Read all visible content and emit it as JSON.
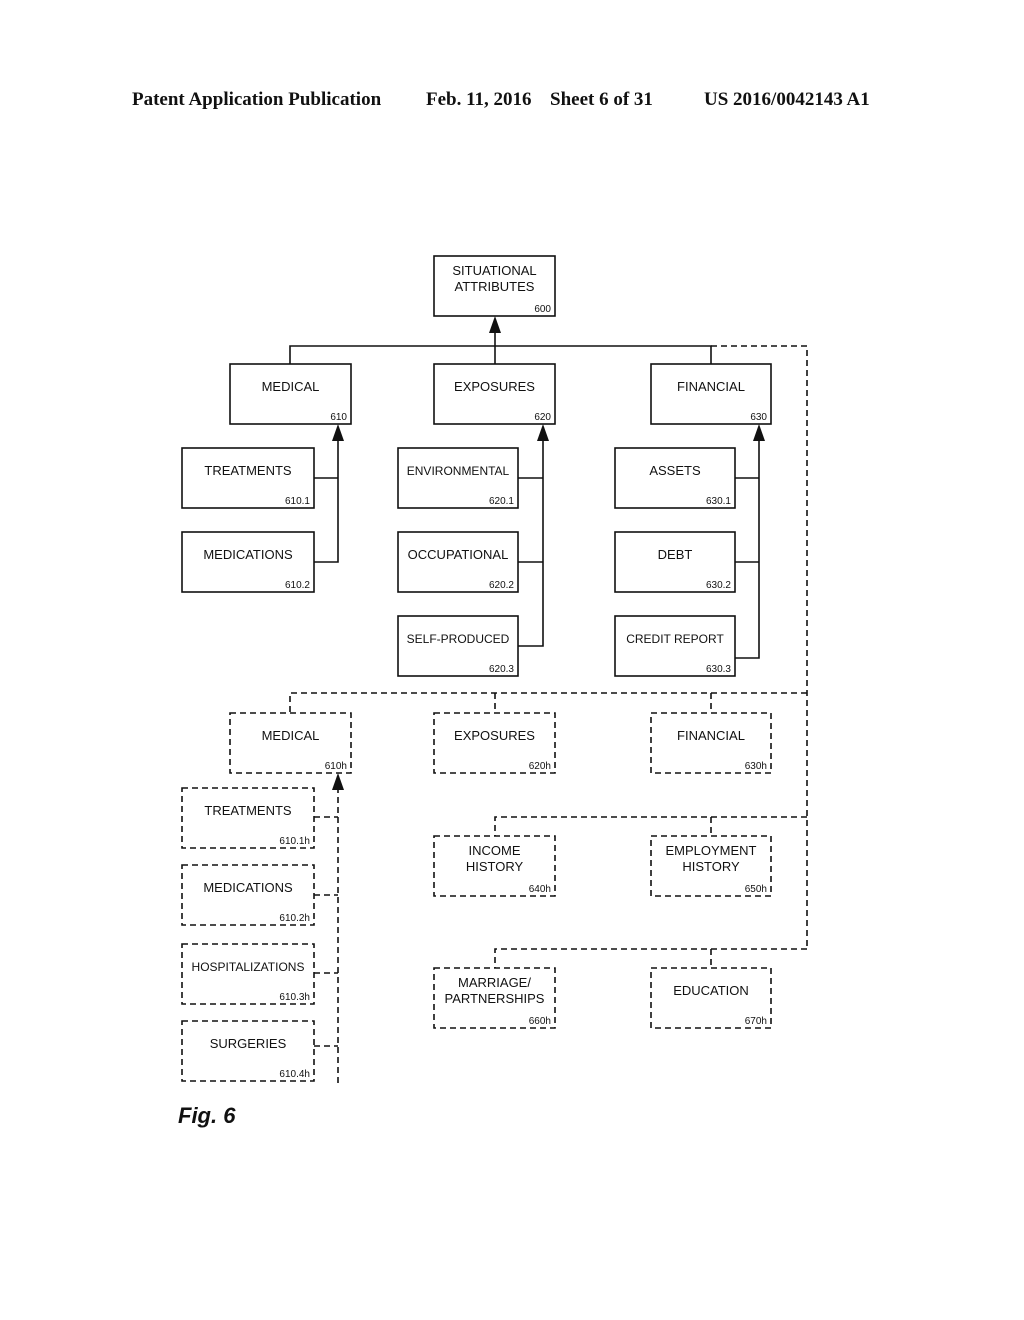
{
  "header": {
    "publication": "Patent Application Publication",
    "date": "Feb. 11, 2016",
    "sheet": "Sheet 6 of 31",
    "number": "US 2016/0042143 A1"
  },
  "figure_label": "Fig. 6",
  "diagram": {
    "root": {
      "id": "root",
      "lines": [
        "SITUATIONAL",
        "ATTRIBUTES"
      ],
      "ref": "600",
      "style": "solid"
    },
    "nodes": [
      {
        "id": "n610",
        "lines": [
          "MEDICAL"
        ],
        "ref": "610",
        "style": "solid"
      },
      {
        "id": "n620",
        "lines": [
          "EXPOSURES"
        ],
        "ref": "620",
        "style": "solid"
      },
      {
        "id": "n630",
        "lines": [
          "FINANCIAL"
        ],
        "ref": "630",
        "style": "solid"
      },
      {
        "id": "n610_1",
        "lines": [
          "TREATMENTS"
        ],
        "ref": "610.1",
        "style": "solid"
      },
      {
        "id": "n610_2",
        "lines": [
          "MEDICATIONS"
        ],
        "ref": "610.2",
        "style": "solid"
      },
      {
        "id": "n620_1",
        "lines": [
          "ENVIRONMENTAL"
        ],
        "ref": "620.1",
        "style": "solid"
      },
      {
        "id": "n620_2",
        "lines": [
          "OCCUPATIONAL"
        ],
        "ref": "620.2",
        "style": "solid"
      },
      {
        "id": "n620_3",
        "lines": [
          "SELF-PRODUCED"
        ],
        "ref": "620.3",
        "style": "solid"
      },
      {
        "id": "n630_1",
        "lines": [
          "ASSETS"
        ],
        "ref": "630.1",
        "style": "solid"
      },
      {
        "id": "n630_2",
        "lines": [
          "DEBT"
        ],
        "ref": "630.2",
        "style": "solid"
      },
      {
        "id": "n630_3",
        "lines": [
          "CREDIT REPORT"
        ],
        "ref": "630.3",
        "style": "solid"
      },
      {
        "id": "n610h",
        "lines": [
          "MEDICAL"
        ],
        "ref": "610h",
        "style": "dashed"
      },
      {
        "id": "n620h",
        "lines": [
          "EXPOSURES"
        ],
        "ref": "620h",
        "style": "dashed"
      },
      {
        "id": "n630h",
        "lines": [
          "FINANCIAL"
        ],
        "ref": "630h",
        "style": "dashed"
      },
      {
        "id": "n610_1h",
        "lines": [
          "TREATMENTS"
        ],
        "ref": "610.1h",
        "style": "dashed"
      },
      {
        "id": "n610_2h",
        "lines": [
          "MEDICATIONS"
        ],
        "ref": "610.2h",
        "style": "dashed"
      },
      {
        "id": "n610_3h",
        "lines": [
          "HOSPITALIZATIONS"
        ],
        "ref": "610.3h",
        "style": "dashed"
      },
      {
        "id": "n610_4h",
        "lines": [
          "SURGERIES"
        ],
        "ref": "610.4h",
        "style": "dashed"
      },
      {
        "id": "n640h",
        "lines": [
          "INCOME",
          "HISTORY"
        ],
        "ref": "640h",
        "style": "dashed"
      },
      {
        "id": "n650h",
        "lines": [
          "EMPLOYMENT",
          "HISTORY"
        ],
        "ref": "650h",
        "style": "dashed"
      },
      {
        "id": "n660h",
        "lines": [
          "MARRIAGE/",
          "PARTNERSHIPS"
        ],
        "ref": "660h",
        "style": "dashed"
      },
      {
        "id": "n670h",
        "lines": [
          "EDUCATION"
        ],
        "ref": "670h",
        "style": "dashed"
      }
    ],
    "edges": [
      {
        "from": "n610",
        "to": "root",
        "style": "solid"
      },
      {
        "from": "n620",
        "to": "root",
        "style": "solid"
      },
      {
        "from": "n630",
        "to": "root",
        "style": "solid"
      },
      {
        "from": "n610_1",
        "to": "n610",
        "style": "solid"
      },
      {
        "from": "n610_2",
        "to": "n610",
        "style": "solid"
      },
      {
        "from": "n620_1",
        "to": "n620",
        "style": "solid"
      },
      {
        "from": "n620_2",
        "to": "n620",
        "style": "solid"
      },
      {
        "from": "n620_3",
        "to": "n620",
        "style": "solid"
      },
      {
        "from": "n630_1",
        "to": "n630",
        "style": "solid"
      },
      {
        "from": "n630_2",
        "to": "n630",
        "style": "solid"
      },
      {
        "from": "n630_3",
        "to": "n630",
        "style": "solid"
      },
      {
        "from": "n610h",
        "to": "root",
        "style": "dashed"
      },
      {
        "from": "n620h",
        "to": "root",
        "style": "dashed"
      },
      {
        "from": "n630h",
        "to": "root",
        "style": "dashed"
      },
      {
        "from": "n640h",
        "to": "root",
        "style": "dashed"
      },
      {
        "from": "n650h",
        "to": "root",
        "style": "dashed"
      },
      {
        "from": "n660h",
        "to": "root",
        "style": "dashed"
      },
      {
        "from": "n670h",
        "to": "root",
        "style": "dashed"
      },
      {
        "from": "n610_1h",
        "to": "n610h",
        "style": "dashed"
      },
      {
        "from": "n610_2h",
        "to": "n610h",
        "style": "dashed"
      },
      {
        "from": "n610_3h",
        "to": "n610h",
        "style": "dashed"
      },
      {
        "from": "n610_4h",
        "to": "n610h",
        "style": "dashed"
      }
    ]
  }
}
